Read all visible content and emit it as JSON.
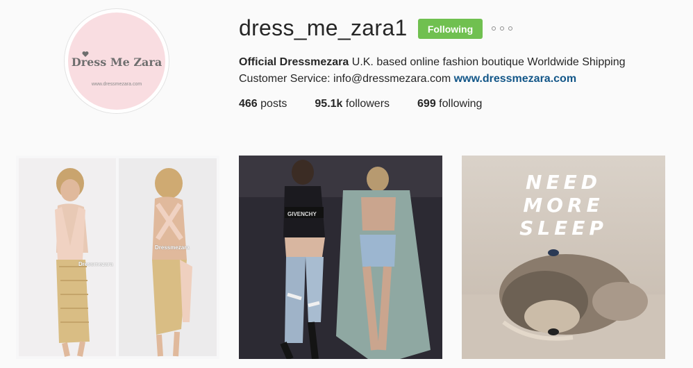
{
  "profile": {
    "username": "dress_me_zara1",
    "follow_label": "Following",
    "avatar": {
      "brand_name": "Dress Me Zara",
      "brand_url": "www.dressmezara.com"
    },
    "bio": {
      "name": "Official Dressmezara",
      "text": " U.K. based online fashion boutique Worldwide Shipping Customer Service: info@dressmezara.com ",
      "link": "www.dressmezara.com"
    },
    "stats": {
      "posts_count": "466",
      "posts_label": " posts",
      "followers_count": "95.1k",
      "followers_label": " followers",
      "following_count": "699",
      "following_label": " following"
    }
  },
  "posts": [
    {
      "watermark": "Dressmezara"
    },
    {
      "top_text": "GIVENCHY"
    },
    {
      "lines": [
        "NEED",
        "MORE",
        "SLEEP"
      ]
    }
  ],
  "colors": {
    "follow_button": "#70c050",
    "link": "#125688",
    "avatar_bg": "#f9dde1"
  },
  "icons": [
    "more-options-icon",
    "heart-icon"
  ]
}
